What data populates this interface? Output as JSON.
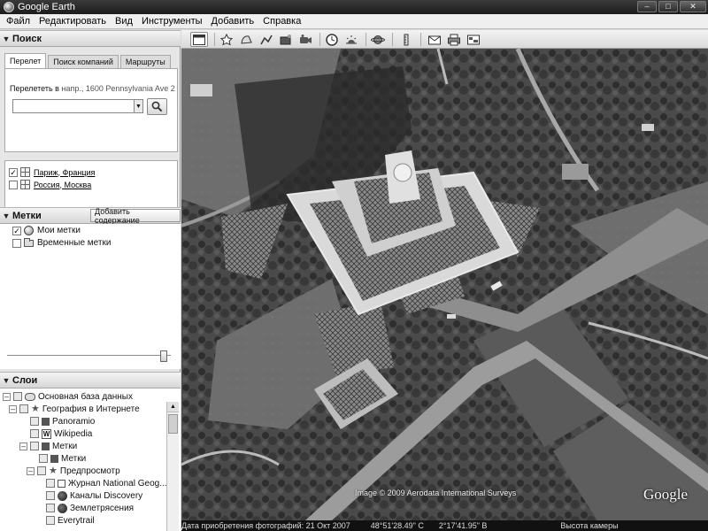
{
  "window": {
    "title": "Google Earth"
  },
  "menu": [
    "Файл",
    "Редактировать",
    "Вид",
    "Инструменты",
    "Добавить",
    "Справка"
  ],
  "search": {
    "header": "Поиск",
    "tabs": [
      "Перелет",
      "Поиск компаний",
      "Маршруты"
    ],
    "fly_label": "Перелететь в",
    "fly_hint": "напр., 1600 Pennsylvania Ave 2",
    "fly_value": "",
    "results": [
      {
        "label": "Париж, Франция",
        "checked": true
      },
      {
        "label": "Россия, Москва",
        "checked": false
      }
    ],
    "clear_symbol": "×"
  },
  "places": {
    "header": "Метки",
    "add_content_label": "Добавить содержание",
    "items": [
      {
        "label": "Мои метки",
        "checked": true
      },
      {
        "label": "Временные метки",
        "checked": false
      }
    ],
    "slider_value": 1.0
  },
  "layers": {
    "header": "Слои",
    "items": [
      {
        "label": "Основная база данных",
        "depth": 0
      },
      {
        "label": "География в Интернете",
        "depth": 1
      },
      {
        "label": "Panoramio",
        "depth": 2
      },
      {
        "label": "Wikipedia",
        "depth": 2
      },
      {
        "label": "Метки",
        "depth": 2
      },
      {
        "label": "Метки",
        "depth": 3
      },
      {
        "label": "Предпросмотр",
        "depth": 2
      },
      {
        "label": "Журнал National Geog...",
        "depth": 3
      },
      {
        "label": "Каналы Discovery",
        "depth": 3
      },
      {
        "label": "Землетрясения",
        "depth": 3
      },
      {
        "label": "Everytrail",
        "depth": 3
      }
    ]
  },
  "map": {
    "copyright": "Image © 2009 Aerodata International Surveys",
    "logo": "Google"
  },
  "status": {
    "date_label": "Дата приобретения фотографий: 21 Окт 2007",
    "latitude": "48°51'28.49\" С",
    "longitude": "2°17'41.95\" В",
    "altitude_label": "Высота камеры"
  }
}
